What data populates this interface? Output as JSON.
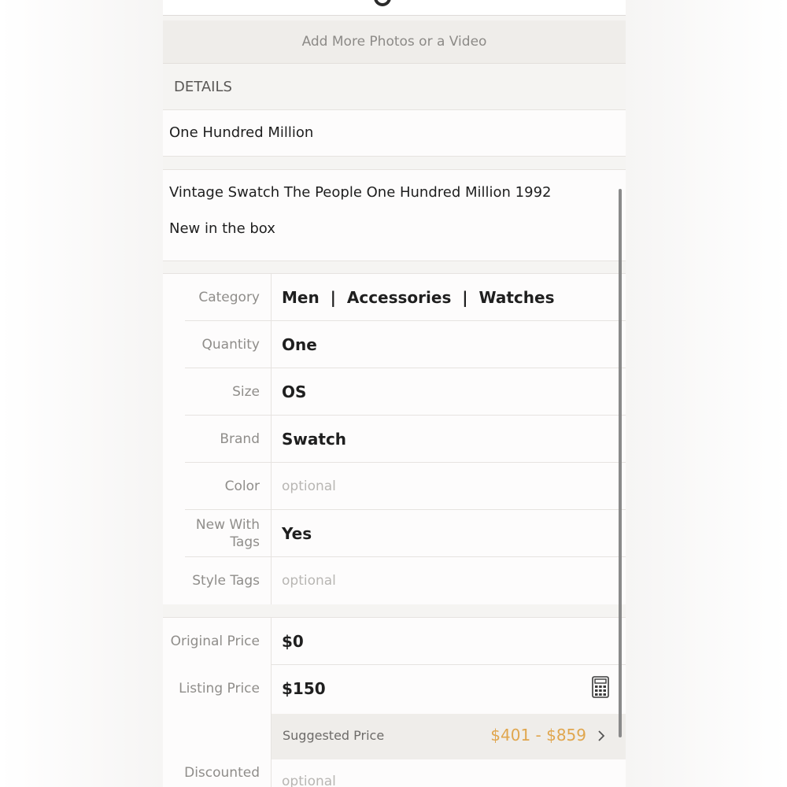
{
  "add_media": {
    "label": "Add More Photos or a Video"
  },
  "details": {
    "section_title": "DETAILS",
    "title_value": "One Hundred Million",
    "description_line1": "Vintage Swatch The People One Hundred Million 1992",
    "description_line2": "New in the box"
  },
  "attributes": [
    {
      "label": "Category",
      "value": "Men  |  Accessories  |  Watches",
      "is_placeholder": false
    },
    {
      "label": "Quantity",
      "value": "One",
      "is_placeholder": false
    },
    {
      "label": "Size",
      "value": "OS",
      "is_placeholder": false
    },
    {
      "label": "Brand",
      "value": "Swatch",
      "is_placeholder": false
    },
    {
      "label": "Color",
      "value": "optional",
      "is_placeholder": true
    },
    {
      "label": "New With Tags",
      "value": "Yes",
      "is_placeholder": false
    },
    {
      "label": "Style Tags",
      "value": "optional",
      "is_placeholder": true
    }
  ],
  "pricing": {
    "original_price_label": "Original Price",
    "original_price_value": "$0",
    "listing_price_label": "Listing Price",
    "listing_price_value": "$150",
    "suggested_label": "Suggested Price",
    "suggested_range": "$401 - $859",
    "discounted_label": "Discounted",
    "discounted_value": "optional"
  },
  "icons": {
    "calculator": "calculator-icon",
    "chevron": "chevron-right-icon"
  },
  "colors": {
    "accent": "#e0a64e",
    "background": "#f5f4f2",
    "panel": "#fdfcfc"
  }
}
